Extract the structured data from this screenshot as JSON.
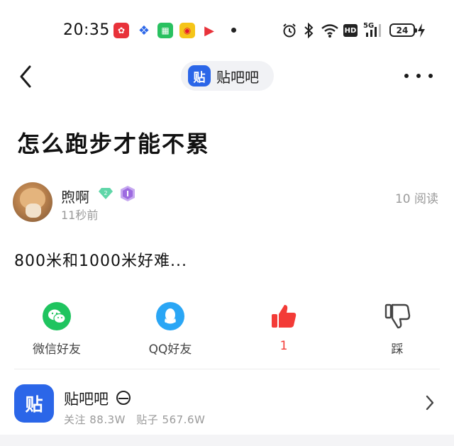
{
  "status_bar": {
    "time": "20:35",
    "battery": "24",
    "network": "5G",
    "hd_label": "HD"
  },
  "nav": {
    "forum_logo_char": "贴",
    "forum_name": "贴吧吧"
  },
  "post": {
    "title": "怎么跑步才能不累",
    "author": "煦啊",
    "author_level": "2",
    "time_ago": "11秒前",
    "reads": "10 阅读",
    "body": "800米和1000米好难..."
  },
  "actions": {
    "wechat": "微信好友",
    "qq": "QQ好友",
    "like_count": "1",
    "dislike": "踩"
  },
  "forum_card": {
    "logo_char": "贴",
    "name": "贴吧吧",
    "followers": "关注 88.3W",
    "posts": "贴子 567.6W"
  },
  "colors": {
    "brand_blue": "#2b66e8",
    "wechat_green": "#1fc45f",
    "qq_blue": "#2aa6f5",
    "like_red": "#f33b37"
  }
}
